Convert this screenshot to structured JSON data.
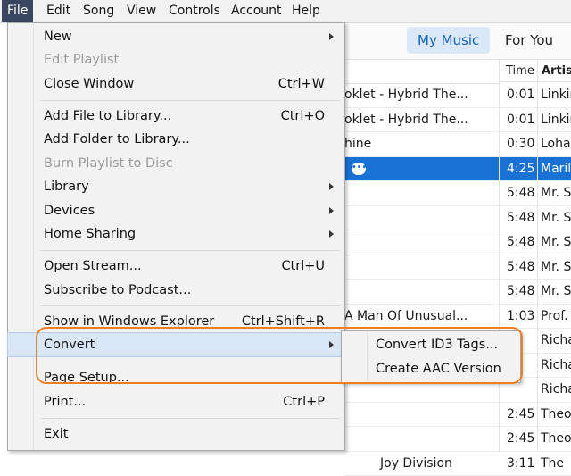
{
  "menubar": {
    "items": [
      "File",
      "Edit",
      "Song",
      "View",
      "Controls",
      "Account",
      "Help"
    ]
  },
  "header": {
    "tabs": [
      "My Music",
      "For You"
    ]
  },
  "table": {
    "columns": {
      "time": "Time",
      "artist": "Artist"
    },
    "rows": [
      {
        "title": "oklet - Hybrid The...",
        "time": "0:01",
        "artist": "Linkin"
      },
      {
        "title": "oklet - Hybrid The...",
        "time": "0:01",
        "artist": "Linkin"
      },
      {
        "title": "hine",
        "time": "0:30",
        "artist": "Lohan"
      },
      {
        "title": "",
        "time": "4:25",
        "artist": "Marily"
      },
      {
        "title": "",
        "time": "5:48",
        "artist": "Mr. S"
      },
      {
        "title": "",
        "time": "5:48",
        "artist": "Mr. S"
      },
      {
        "title": "",
        "time": "5:48",
        "artist": "Mr. S"
      },
      {
        "title": "",
        "time": "5:48",
        "artist": "Mr. S"
      },
      {
        "title": "",
        "time": "5:48",
        "artist": "Mr. S"
      },
      {
        "title": "A Man Of Unusual...",
        "time": "1:03",
        "artist": "Prof."
      },
      {
        "title": "",
        "time": "",
        "artist": "Richa"
      },
      {
        "title": "",
        "time": "",
        "artist": "Richa"
      },
      {
        "title": "",
        "time": "",
        "artist": "Richa"
      },
      {
        "title": "",
        "time": "2:45",
        "artist": "Theo"
      },
      {
        "title": "",
        "time": "2:45",
        "artist": "Theo"
      },
      {
        "title": "Joy Division",
        "time": "3:11",
        "artist": "The"
      }
    ]
  },
  "file_menu": {
    "new": "New",
    "edit_playlist": "Edit Playlist",
    "close_window": "Close Window",
    "close_window_sc": "Ctrl+W",
    "add_file": "Add File to Library...",
    "add_file_sc": "Ctrl+O",
    "add_folder": "Add Folder to Library...",
    "burn_playlist": "Burn Playlist to Disc",
    "library": "Library",
    "devices": "Devices",
    "home_sharing": "Home Sharing",
    "open_stream": "Open Stream...",
    "open_stream_sc": "Ctrl+U",
    "subscribe_podcast": "Subscribe to Podcast...",
    "show_explorer": "Show in Windows Explorer",
    "show_explorer_sc": "Ctrl+Shift+R",
    "convert": "Convert",
    "page_setup": "Page Setup...",
    "print": "Print...",
    "print_sc": "Ctrl+P",
    "exit": "Exit"
  },
  "convert_submenu": {
    "id3": "Convert ID3 Tags...",
    "aac": "Create AAC Version"
  },
  "colors": {
    "accent": "#1971d4",
    "callout": "#ef7d22"
  }
}
